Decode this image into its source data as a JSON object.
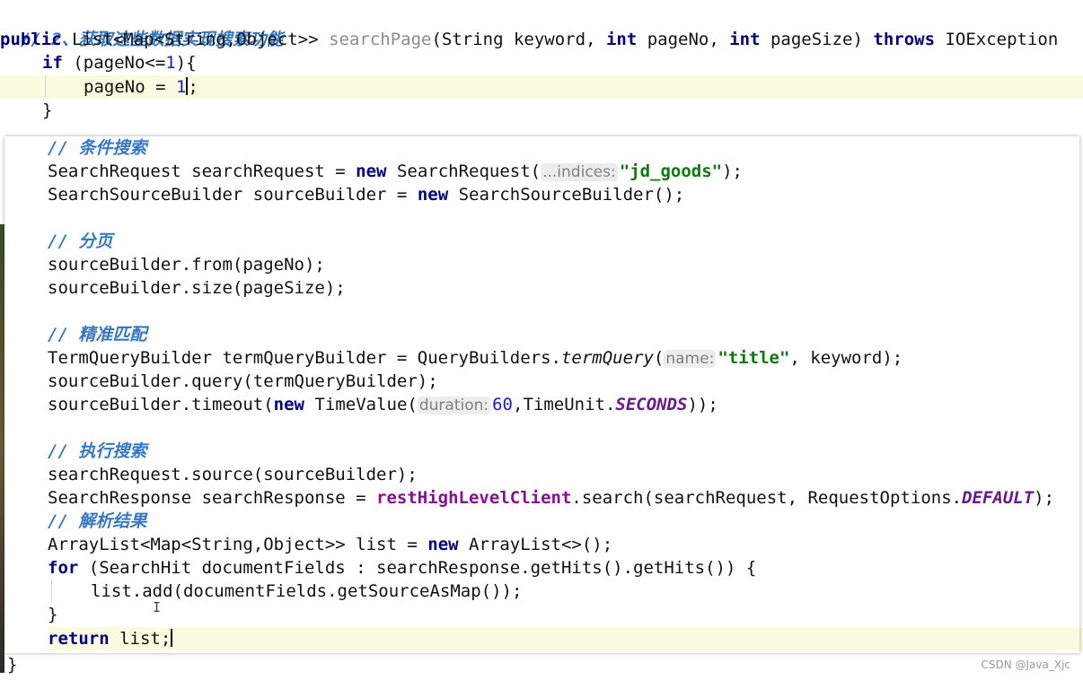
{
  "editor": {
    "header": {
      "comment": "// 2、获取这些数据实现搜索功能",
      "signature": {
        "kw_public": "public",
        "return_type": "List<Map<String,Object>> ",
        "method": "searchPage",
        "params_open": "(String keyword, ",
        "kw_int1": "int",
        "param2": " pageNo, ",
        "kw_int2": "int",
        "param3": " pageSize) ",
        "kw_throws": "throws",
        "exception": " IOException"
      },
      "if_kw": "if",
      "if_cond_a": " (pageNo<=",
      "if_num": "1",
      "if_cond_b": "){",
      "assign_a": "pageNo = ",
      "assign_num": "1",
      "assign_b": ";",
      "close_brace": "}"
    },
    "body": {
      "comment_condition": "// 条件搜索",
      "line_req_a": "SearchRequest searchRequest = ",
      "kw_new1": "new",
      "line_req_b": " SearchRequest(",
      "hint_indices": "...indices:",
      "str_index": "\"jd_goods\"",
      "line_req_c": ");",
      "line_ssb_a": "SearchSourceBuilder sourceBuilder = ",
      "kw_new2": "new",
      "line_ssb_b": " SearchSourceBuilder();",
      "comment_paging": "// 分页",
      "line_from": "sourceBuilder.from(pageNo);",
      "line_size": "sourceBuilder.size(pageSize);",
      "comment_exact": "// 精准匹配",
      "line_tq_a": "TermQueryBuilder termQueryBuilder = QueryBuilders.",
      "tq_method": "termQuery",
      "line_tq_b": "(",
      "hint_name": "name:",
      "str_title": "\"title\"",
      "line_tq_c": ", keyword);",
      "line_query": "sourceBuilder.query(termQueryBuilder);",
      "line_to_a": "sourceBuilder.timeout(",
      "kw_new3": "new",
      "line_to_b": " TimeValue(",
      "hint_duration": "duration:",
      "num_60": "60",
      "line_to_c": ",TimeUnit.",
      "static_seconds": "SECONDS",
      "line_to_d": "));",
      "comment_execute": "// 执行搜索",
      "line_source": "searchRequest.source(sourceBuilder);",
      "line_resp_a": "SearchResponse searchResponse = ",
      "field_client": "restHighLevelClient",
      "line_resp_b": ".search(searchRequest, RequestOptions.",
      "static_default": "DEFAULT",
      "line_resp_c": ");",
      "comment_parse": "// 解析结果",
      "line_list_a": "ArrayList<Map<String,Object>> list = ",
      "kw_new4": "new",
      "line_list_b": " ArrayList<>();",
      "kw_for": "for",
      "line_for_b": " (SearchHit documentFields : searchResponse.getHits().getHits()) {",
      "line_add": "list.add(documentFields.getSourceAsMap());",
      "line_close_for": "}",
      "kw_return": "return",
      "line_return_b": " list;",
      "line_close_method": "}"
    }
  },
  "watermark": "CSDN @Java_Xjc",
  "colors": {
    "keyword": "#000080",
    "comment": "#3578c4",
    "number": "#1a1ad6",
    "string": "#0c7a0c",
    "field": "#871094",
    "highlight": "#fcfadf"
  }
}
